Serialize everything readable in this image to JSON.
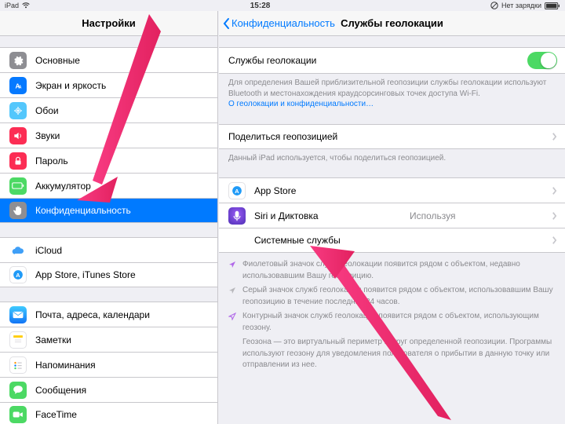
{
  "status": {
    "device": "iPad",
    "time": "15:28",
    "charging": "Нет зарядки"
  },
  "sidebar": {
    "title": "Настройки",
    "items": [
      {
        "label": "Основные"
      },
      {
        "label": "Экран и яркость"
      },
      {
        "label": "Обои"
      },
      {
        "label": "Звуки"
      },
      {
        "label": "Пароль"
      },
      {
        "label": "Аккумулятор"
      },
      {
        "label": "Конфиденциальность"
      },
      {
        "label": "iCloud"
      },
      {
        "label": "App Store, iTunes Store"
      },
      {
        "label": "Почта, адреса, календари"
      },
      {
        "label": "Заметки"
      },
      {
        "label": "Напоминания"
      },
      {
        "label": "Сообщения"
      },
      {
        "label": "FaceTime"
      }
    ]
  },
  "detail": {
    "back": "Конфиденциальность",
    "title": "Службы геолокации",
    "toggle_label": "Службы геолокации",
    "toggle_footer": "Для определения Вашей приблизительной геопозиции службы геолокации используют Bluetooth и местонахождения краудсорсинговых точек доступа Wi-Fi.",
    "toggle_footer_link": "О геолокации и конфиденциальности…",
    "share_label": "Поделиться геопозицией",
    "share_footer": "Данный iPad используется, чтобы поделиться геопозицией.",
    "apps": [
      {
        "label": "App Store",
        "status": ""
      },
      {
        "label": "Siri и Диктовка",
        "status": "Используя"
      },
      {
        "label": "Системные службы",
        "status": ""
      }
    ],
    "legend": {
      "l1": "Фиолетовый значок служб геолокации появится рядом с объектом, недавно использовавшим Вашу геопозицию.",
      "l2": "Серый значок служб геолокации появится рядом с объектом, использовавшим Вашу геопозицию в течение последних 24 часов.",
      "l3": "Контурный значок служб геолокации появится рядом с объектом, использующим геозону.",
      "l4": "Геозона — это виртуальный периметр вокруг определенной геопозиции. Программы используют геозону для уведомления пользователя о прибытии в данную точку или отправлении из нее."
    }
  }
}
